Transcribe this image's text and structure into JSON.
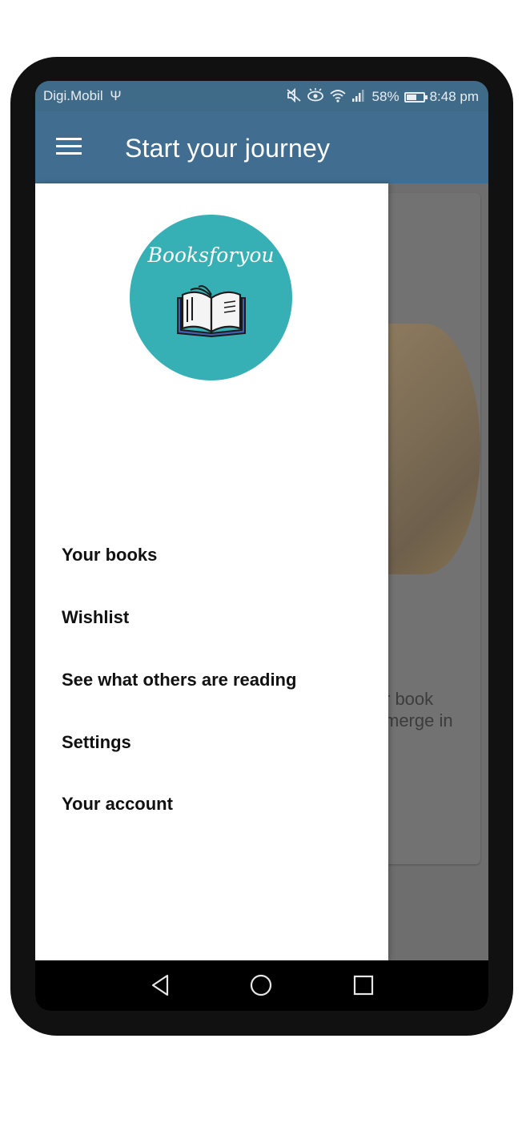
{
  "status_bar": {
    "carrier": "Digi.Mobil",
    "battery_percent": "58%",
    "battery_level": 0.58,
    "time": "8:48 pm",
    "icons": [
      "usb-icon",
      "mute-icon",
      "eye-comfort-icon",
      "wifi-icon",
      "signal-icon",
      "battery-icon"
    ]
  },
  "app_bar": {
    "title": "Start your journey",
    "menu_icon": "hamburger-menu-icon"
  },
  "drawer": {
    "logo_text": "Booksforyou",
    "items": [
      {
        "label": "Your books"
      },
      {
        "label": "Wishlist"
      },
      {
        "label": "See what others are reading"
      },
      {
        "label": "Settings"
      },
      {
        "label": "Your account"
      }
    ]
  },
  "background": {
    "text_partial": "r book\nmerge in"
  },
  "colors": {
    "app_bar": "#416e90",
    "status_bar": "#3f6a88",
    "logo_bg": "#37b0b5"
  },
  "system_nav": {
    "buttons": [
      "back-icon",
      "home-icon",
      "recents-icon"
    ]
  }
}
